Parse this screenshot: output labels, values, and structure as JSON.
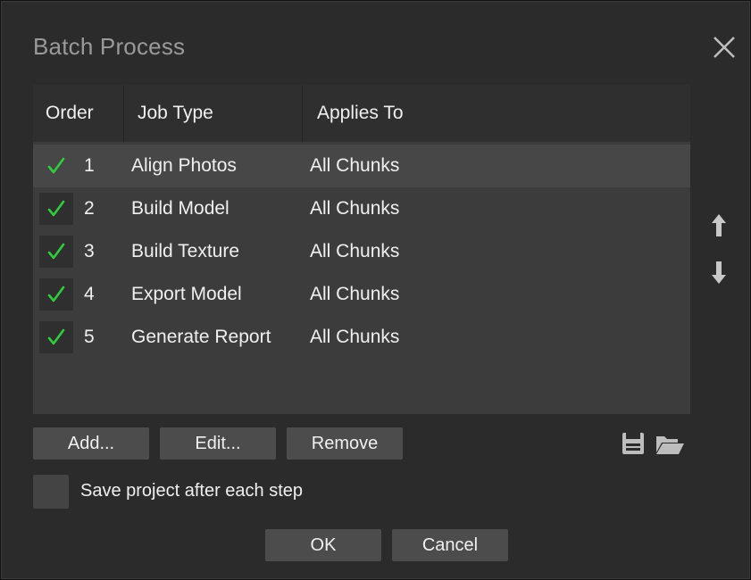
{
  "dialog": {
    "title": "Batch Process",
    "close_icon": "close-icon"
  },
  "table": {
    "columns": [
      "Order",
      "Job Type",
      "Applies To"
    ],
    "rows": [
      {
        "checked": true,
        "order": "1",
        "job_type": "Align Photos",
        "applies_to": "All Chunks",
        "selected": true
      },
      {
        "checked": true,
        "order": "2",
        "job_type": "Build Model",
        "applies_to": "All Chunks",
        "selected": false
      },
      {
        "checked": true,
        "order": "3",
        "job_type": "Build Texture",
        "applies_to": "All Chunks",
        "selected": false
      },
      {
        "checked": true,
        "order": "4",
        "job_type": "Export Model",
        "applies_to": "All Chunks",
        "selected": false
      },
      {
        "checked": true,
        "order": "5",
        "job_type": "Generate Report",
        "applies_to": "All Chunks",
        "selected": false
      }
    ]
  },
  "side_controls": {
    "move_up_icon": "arrow-up-icon",
    "move_down_icon": "arrow-down-icon"
  },
  "buttons": {
    "add_label": "Add...",
    "edit_label": "Edit...",
    "remove_label": "Remove",
    "ok_label": "OK",
    "cancel_label": "Cancel"
  },
  "file_icons": {
    "save_icon": "save-icon",
    "open_icon": "folder-open-icon"
  },
  "options": {
    "save_after_each_step_label": "Save project after each step",
    "save_after_each_step_checked": false
  },
  "colors": {
    "check_green": "#2ecc40",
    "dialog_bg": "#2b2b2b",
    "table_bg": "#3c3c3c",
    "button_bg": "#4c4c4c"
  }
}
